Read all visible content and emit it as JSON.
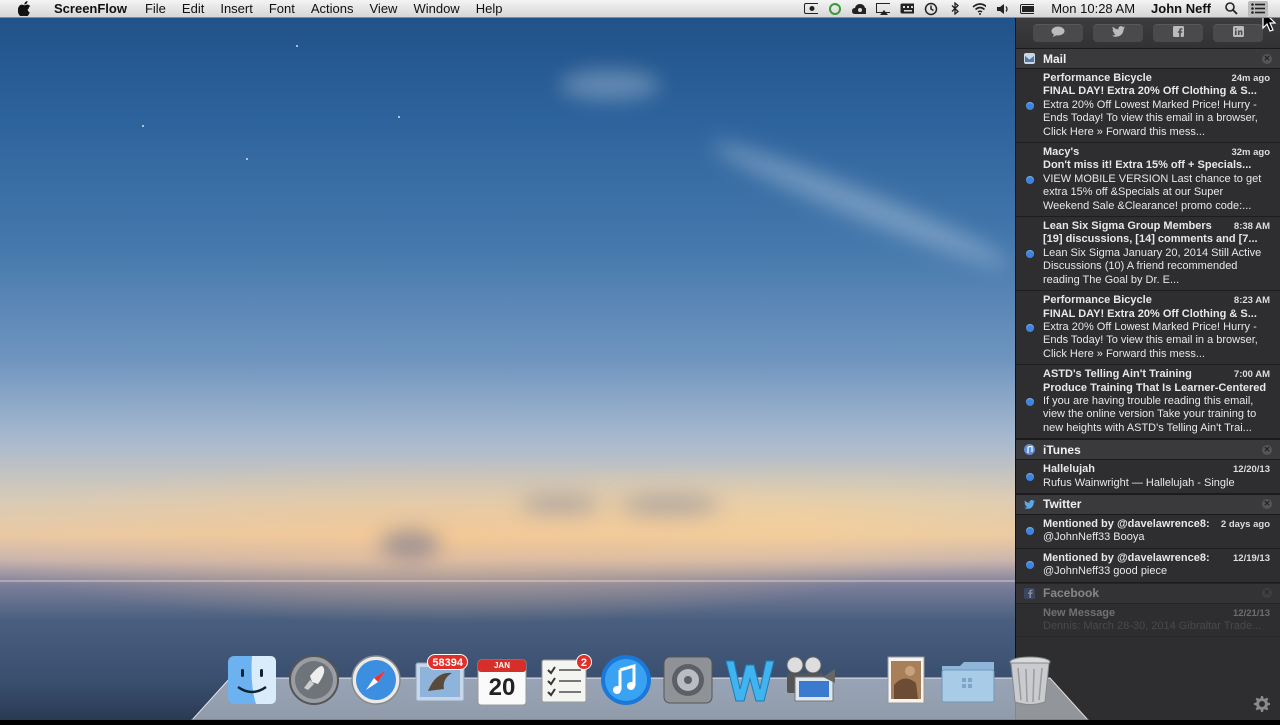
{
  "menubar": {
    "app_name": "ScreenFlow",
    "menus": [
      "File",
      "Edit",
      "Insert",
      "Font",
      "Actions",
      "View",
      "Window",
      "Help"
    ],
    "clock": "Mon 10:28 AM",
    "user": "John Neff"
  },
  "notification_center": {
    "share_buttons": [
      "messages-icon",
      "twitter-icon",
      "facebook-icon",
      "linkedin-icon"
    ],
    "sections": {
      "mail": {
        "title": "Mail",
        "items": [
          {
            "sender": "Performance Bicycle",
            "time": "24m ago",
            "subject": "FINAL DAY! Extra 20% Off Clothing & S...",
            "body": "Extra 20% Off Lowest Marked Price! Hurry - Ends Today! To view this email in a browser, Click Here » Forward this mess..."
          },
          {
            "sender": "Macy's",
            "time": "32m ago",
            "subject": "Don't miss it! Extra 15% off + Specials...",
            "body": "VIEW MOBILE VERSION Last chance to get extra 15% off &Specials at our Super Weekend Sale &Clearance! promo code:..."
          },
          {
            "sender": "Lean Six Sigma Group Members",
            "time": "8:38 AM",
            "subject": "[19] discussions, [14] comments and [7...",
            "body": "Lean Six Sigma January 20, 2014 Still Active Discussions (10) A friend recommended reading The Goal by Dr. E..."
          },
          {
            "sender": "Performance Bicycle",
            "time": "8:23 AM",
            "subject": "FINAL DAY! Extra 20% Off Clothing & S...",
            "body": "Extra 20% Off Lowest Marked Price! Hurry - Ends Today! To view this email in a browser, Click Here » Forward this mess..."
          },
          {
            "sender": "ASTD's Telling Ain't Training",
            "time": "7:00 AM",
            "subject": "Produce Training That Is Learner-Centered",
            "body": "If you are having trouble reading this email, view the online version Take your training to new heights with ASTD's Telling Ain't Trai..."
          }
        ]
      },
      "itunes": {
        "title": "iTunes",
        "items": [
          {
            "sender": "Hallelujah",
            "time": "12/20/13",
            "body": "Rufus Wainwright — Hallelujah - Single"
          }
        ]
      },
      "twitter": {
        "title": "Twitter",
        "items": [
          {
            "sender": "Mentioned by @davelawrence8:",
            "time": "2 days ago",
            "body": "@JohnNeff33 Booya"
          },
          {
            "sender": "Mentioned by @davelawrence8:",
            "time": "12/19/13",
            "body": "@JohnNeff33 good piece"
          }
        ]
      },
      "facebook": {
        "title": "Facebook",
        "items": [
          {
            "sender": "New Message",
            "time": "12/21/13",
            "body": "Dennis: March 28-30, 2014 Gibraltar Trade..."
          }
        ]
      }
    }
  },
  "dock": {
    "items": [
      {
        "name": "finder-icon",
        "label": "Finder"
      },
      {
        "name": "launchpad-icon",
        "label": "Launchpad"
      },
      {
        "name": "safari-icon",
        "label": "Safari"
      },
      {
        "name": "mail-icon",
        "label": "Mail",
        "badge": "58394"
      },
      {
        "name": "calendar-icon",
        "label": "Calendar",
        "month": "JAN",
        "day": "20"
      },
      {
        "name": "reminders-icon",
        "label": "Reminders",
        "badge": "2"
      },
      {
        "name": "itunes-icon",
        "label": "iTunes"
      },
      {
        "name": "system-preferences-icon",
        "label": "System Preferences"
      },
      {
        "name": "word-icon",
        "label": "Word"
      },
      {
        "name": "imovie-icon",
        "label": "iMovie"
      },
      {
        "name": "photo-stack-icon",
        "label": "Photo"
      },
      {
        "name": "applications-folder-icon",
        "label": "Applications"
      },
      {
        "name": "trash-icon",
        "label": "Trash"
      }
    ]
  },
  "colors": {
    "unread_dot": "#3d84e0",
    "badge": "#e0302a",
    "nc_background": "#2e2e30"
  }
}
